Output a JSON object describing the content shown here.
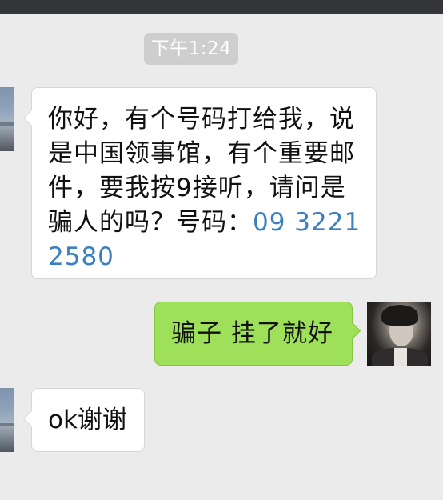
{
  "timestamp": "下午1:24",
  "messages": [
    {
      "side": "left",
      "text": "你好，有个号码打给我，说是中国领事馆，有个重要邮件，要我按9接听，请问是骗人的吗？号码：",
      "phone": "09 3221 2580"
    },
    {
      "side": "right",
      "text": "骗子 挂了就好"
    },
    {
      "side": "left",
      "text": "ok谢谢"
    }
  ],
  "colors": {
    "background": "#ebebeb",
    "incoming_bubble": "#ffffff",
    "outgoing_bubble": "#9fe05b",
    "link": "#3a7fc1",
    "timestamp_pill": "#cecece"
  }
}
